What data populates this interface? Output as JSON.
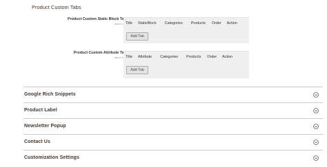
{
  "section": {
    "title": "Product Custom Tabs"
  },
  "static_block_tabs": {
    "label": "Product Custom Static Block Tabs",
    "scope": "[store view]",
    "columns": [
      "Title",
      "StaticBlock",
      "Categories",
      "Products",
      "Order",
      "Action"
    ],
    "add_button": "Add Tab"
  },
  "attribute_tabs": {
    "label": "Product Custom Attribute Tabs",
    "scope": "[store view]",
    "columns": [
      "Title",
      "Attribute",
      "Categories",
      "Products",
      "Order",
      "Action"
    ],
    "add_button": "Add Tab"
  },
  "accordions": [
    {
      "label": "Google Rich Snippets",
      "icon": "chevron-down-circle-icon"
    },
    {
      "label": "Product Label",
      "icon": "chevron-down-circle-icon"
    },
    {
      "label": "Newsletter Popup",
      "icon": "chevron-down-circle-icon"
    },
    {
      "label": "Contact Us",
      "icon": "chevron-down-circle-icon"
    },
    {
      "label": "Customization Settings",
      "icon": "chevron-down-circle-icon"
    }
  ],
  "colors": {
    "table_bg": "#efefef",
    "button_bg": "#e3e3e3",
    "divider": "#cccccc",
    "heading": "#41362f"
  }
}
